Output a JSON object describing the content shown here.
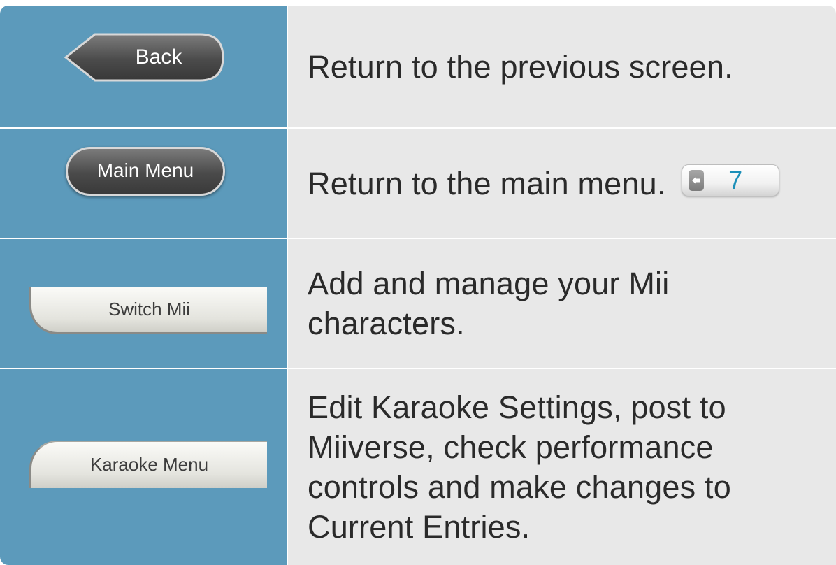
{
  "rows": [
    {
      "button_label": "Back",
      "description": "Return to the previous screen."
    },
    {
      "button_label": "Main Menu",
      "description": "Return to the main menu.",
      "page_ref": "7",
      "page_ref_icon": "left-arrow-icon"
    },
    {
      "button_label": "Switch Mii",
      "description": "Add and manage your Mii\ncharacters."
    },
    {
      "button_label": "Karaoke Menu",
      "description": "Edit Karaoke Settings, post to\nMiiverse, check performance\ncontrols and make changes to\nCurrent Entries."
    }
  ],
  "colors": {
    "icon_column_bg": "#5c9abb",
    "description_bg": "#e8e8e8",
    "page_ref_number": "#1c8fb8"
  }
}
